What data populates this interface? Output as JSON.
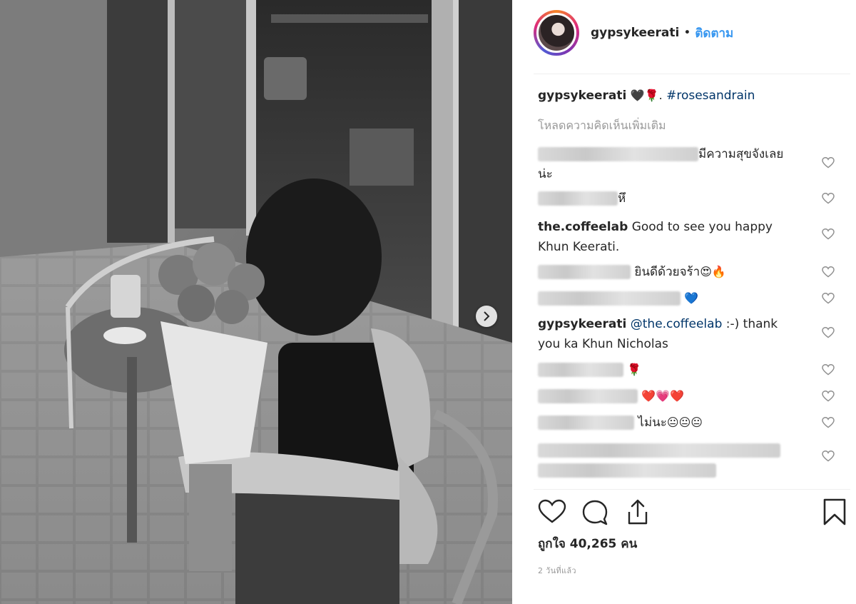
{
  "post": {
    "username": "gypsykeerati",
    "separator": "•",
    "follow_label": "ติดตาม",
    "caption": {
      "username": "gypsykeerati",
      "emojis": "🖤🌹.",
      "hashtag": "#rosesandrain"
    },
    "load_more": "โหลดความคิดเห็นเพิ่มเติม",
    "comments": [
      {
        "username": "",
        "text": "มีความสุขจังเลย",
        "text2": "น่ะ"
      },
      {
        "username": "",
        "text": "หึ"
      },
      {
        "username": "the.coffeelab",
        "text": "Good to see you happy",
        "text2": "Khun Keerati."
      },
      {
        "username": "",
        "text": "ยินดีด้วยจร้า",
        "emoji": "😍🔥"
      },
      {
        "username": "",
        "text": "",
        "emoji": "💙"
      },
      {
        "username": "gypsykeerati",
        "mention": "@the.coffeelab",
        "text": ":-) thank",
        "text2": "you ka Khun Nicholas"
      },
      {
        "username": "",
        "text": "",
        "emoji": "🌹"
      },
      {
        "username": "",
        "text": "",
        "emoji": "❤️💗❤️"
      },
      {
        "username": "",
        "text": "ไม่นะ",
        "emoji": "😐😐😐"
      },
      {
        "username": "",
        "text": ""
      }
    ],
    "likes_text": "ถูกใจ 40,265 คน",
    "time_ago": "2 วันที่แล้ว"
  },
  "icons": {
    "next": "chevron-right-icon",
    "like": "heart-icon",
    "comment": "speech-bubble-icon",
    "share": "share-icon",
    "save": "bookmark-icon",
    "comment_like": "small-heart-icon"
  },
  "colors": {
    "link": "#3897f0",
    "hashtag": "#003569",
    "muted": "#999999",
    "text": "#262626"
  }
}
